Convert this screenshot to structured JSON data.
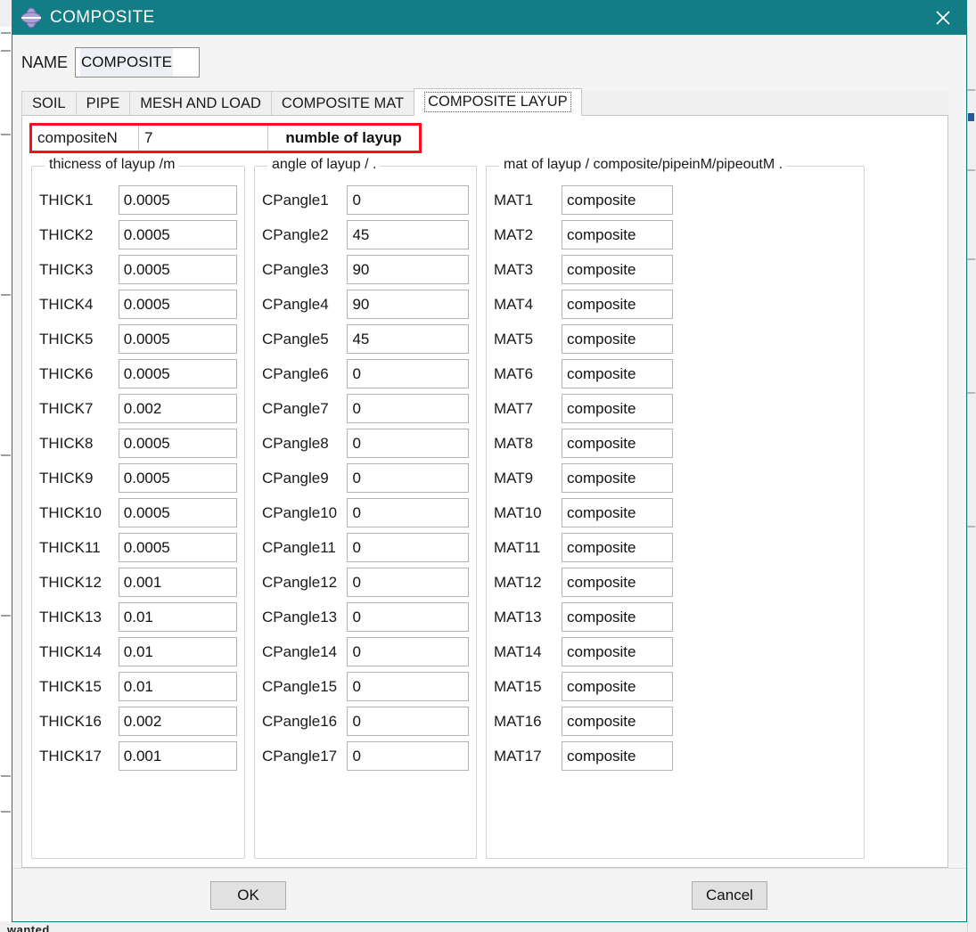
{
  "window": {
    "title": "COMPOSITE",
    "icon": "composite-diamond-icon",
    "close_icon": "close-icon",
    "titlebar_color": "#127d84"
  },
  "name_field": {
    "label": "NAME",
    "value": "COMPOSITE"
  },
  "tabs": [
    {
      "label": "SOIL",
      "active": false
    },
    {
      "label": "PIPE",
      "active": false
    },
    {
      "label": "MESH AND LOAD",
      "active": false
    },
    {
      "label": "COMPOSITE MAT",
      "active": false
    },
    {
      "label": "COMPOSITE LAYUP",
      "active": true
    }
  ],
  "composite_n": {
    "label": "compositeN",
    "value": "7",
    "note": "numble of layup",
    "highlight_color": "#fc0d1b"
  },
  "groups": {
    "thickness": {
      "title": "thicness of layup /m",
      "rows": [
        {
          "label": "THICK1",
          "value": "0.0005"
        },
        {
          "label": "THICK2",
          "value": "0.0005"
        },
        {
          "label": "THICK3",
          "value": "0.0005"
        },
        {
          "label": "THICK4",
          "value": "0.0005"
        },
        {
          "label": "THICK5",
          "value": "0.0005"
        },
        {
          "label": "THICK6",
          "value": "0.0005"
        },
        {
          "label": "THICK7",
          "value": "0.002"
        },
        {
          "label": "THICK8",
          "value": "0.0005"
        },
        {
          "label": "THICK9",
          "value": "0.0005"
        },
        {
          "label": "THICK10",
          "value": "0.0005"
        },
        {
          "label": "THICK11",
          "value": "0.0005"
        },
        {
          "label": "THICK12",
          "value": "0.001"
        },
        {
          "label": "THICK13",
          "value": "0.01"
        },
        {
          "label": "THICK14",
          "value": "0.01"
        },
        {
          "label": "THICK15",
          "value": "0.01"
        },
        {
          "label": "THICK16",
          "value": "0.002"
        },
        {
          "label": "THICK17",
          "value": "0.001"
        }
      ]
    },
    "angle": {
      "title": "angle of layup / .",
      "rows": [
        {
          "label": "CPangle1",
          "value": "0"
        },
        {
          "label": "CPangle2",
          "value": "45"
        },
        {
          "label": "CPangle3",
          "value": "90"
        },
        {
          "label": "CPangle4",
          "value": "90"
        },
        {
          "label": "CPangle5",
          "value": "45"
        },
        {
          "label": "CPangle6",
          "value": "0"
        },
        {
          "label": "CPangle7",
          "value": "0"
        },
        {
          "label": "CPangle8",
          "value": "0"
        },
        {
          "label": "CPangle9",
          "value": "0"
        },
        {
          "label": "CPangle10",
          "value": "0"
        },
        {
          "label": "CPangle11",
          "value": "0"
        },
        {
          "label": "CPangle12",
          "value": "0"
        },
        {
          "label": "CPangle13",
          "value": "0"
        },
        {
          "label": "CPangle14",
          "value": "0"
        },
        {
          "label": "CPangle15",
          "value": "0"
        },
        {
          "label": "CPangle16",
          "value": "0"
        },
        {
          "label": "CPangle17",
          "value": "0"
        }
      ]
    },
    "material": {
      "title": "mat of layup / composite/pipeinM/pipeoutM .",
      "rows": [
        {
          "label": "MAT1",
          "value": "composite"
        },
        {
          "label": "MAT2",
          "value": "composite"
        },
        {
          "label": "MAT3",
          "value": "composite"
        },
        {
          "label": "MAT4",
          "value": "composite"
        },
        {
          "label": "MAT5",
          "value": "composite"
        },
        {
          "label": "MAT6",
          "value": "composite"
        },
        {
          "label": "MAT7",
          "value": "composite"
        },
        {
          "label": "MAT8",
          "value": "composite"
        },
        {
          "label": "MAT9",
          "value": "composite"
        },
        {
          "label": "MAT10",
          "value": "composite"
        },
        {
          "label": "MAT11",
          "value": "composite"
        },
        {
          "label": "MAT12",
          "value": "composite"
        },
        {
          "label": "MAT13",
          "value": "composite"
        },
        {
          "label": "MAT14",
          "value": "composite"
        },
        {
          "label": "MAT15",
          "value": "composite"
        },
        {
          "label": "MAT16",
          "value": "composite"
        },
        {
          "label": "MAT17",
          "value": "composite"
        }
      ]
    }
  },
  "footer": {
    "ok_label": "OK",
    "cancel_label": "Cancel"
  },
  "background": {
    "cut_off_text": "wanted"
  }
}
